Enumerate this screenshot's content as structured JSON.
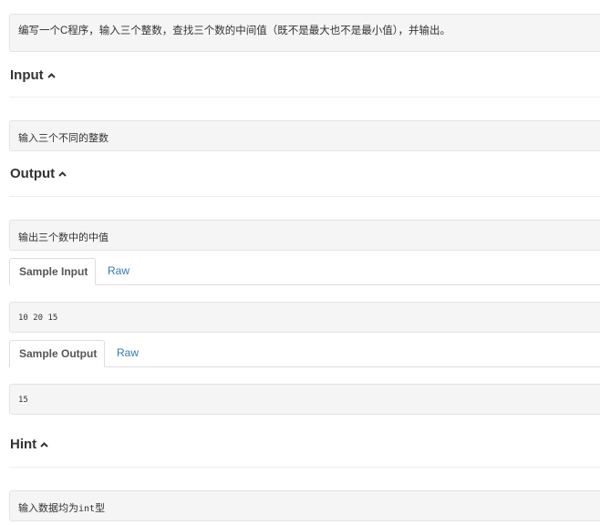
{
  "problem": {
    "description": "编写一个C程序，输入三个整数，查找三个数的中间值（既不是最大也不是最小值），并输出。"
  },
  "input_section": {
    "title": "Input",
    "content": "输入三个不同的整数"
  },
  "output_section": {
    "title": "Output",
    "content": "输出三个数中的中值"
  },
  "sample_input": {
    "tab_label": "Sample Input",
    "raw_label": "Raw",
    "content": "10 20 15"
  },
  "sample_output": {
    "tab_label": "Sample Output",
    "raw_label": "Raw",
    "content": "15"
  },
  "hint_section": {
    "title": "Hint",
    "content_prefix": "输入数据均为",
    "content_code": "int",
    "content_suffix": "型"
  },
  "icons": {
    "collapse": "caret-up-icon"
  },
  "colors": {
    "link": "#337ab7",
    "box_background": "#f5f5f5",
    "box_border": "#e3e3e3"
  }
}
